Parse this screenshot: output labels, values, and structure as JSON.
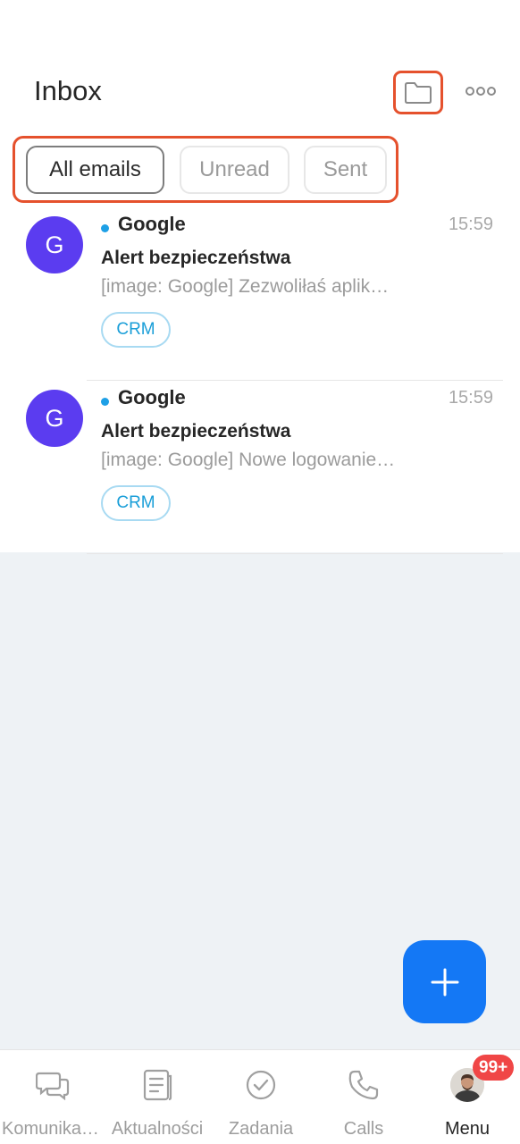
{
  "header": {
    "title": "Inbox",
    "folder_icon": "folder-icon",
    "more_icon": "more-icon"
  },
  "filters": [
    "All emails",
    "Unread",
    "Sent"
  ],
  "emails": [
    {
      "avatar_letter": "G",
      "sender": "Google",
      "time": "15:59",
      "subject": "Alert bezpieczeństwa",
      "preview": "[image: Google] Zezwoliłaś aplik…",
      "tag": "CRM",
      "unread": true
    },
    {
      "avatar_letter": "G",
      "sender": "Google",
      "time": "15:59",
      "subject": "Alert bezpieczeństwa",
      "preview": "[image: Google] Nowe logowanie…",
      "tag": "CRM",
      "unread": true
    }
  ],
  "fab": {
    "icon": "plus-icon"
  },
  "tabbar": {
    "items": [
      {
        "label": "Komunika…",
        "icon": "chat-icon"
      },
      {
        "label": "Aktualności",
        "icon": "news-icon"
      },
      {
        "label": "Zadania",
        "icon": "check-circle-icon"
      },
      {
        "label": "Calls",
        "icon": "phone-icon"
      },
      {
        "label": "Menu",
        "icon": "avatar-icon"
      }
    ],
    "menu_badge": "99+"
  },
  "colors": {
    "highlight": "#e5512d",
    "avatar": "#5b3cf0",
    "unread_dot": "#1ea0e6",
    "fab": "#1478f5",
    "badge": "#f04646"
  }
}
